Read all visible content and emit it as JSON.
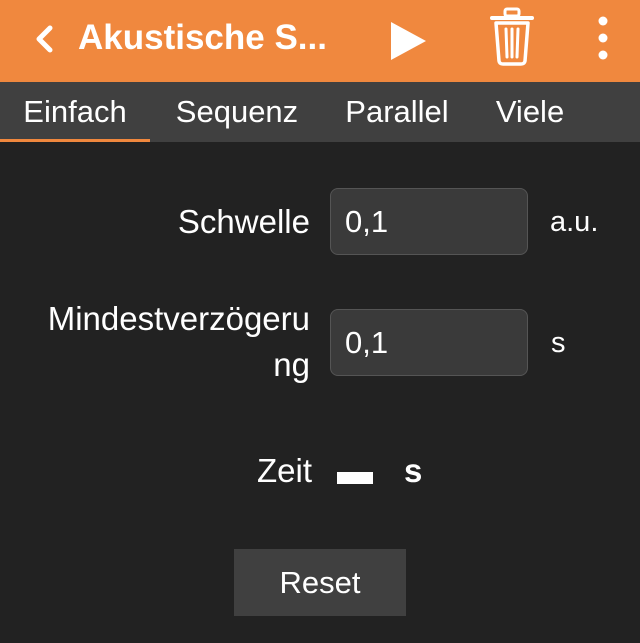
{
  "appbar": {
    "title": "Akustische S...",
    "background_color": "#f0883e",
    "icons": {
      "back": "chevron-left-icon",
      "play": "play-icon",
      "delete": "trash-icon",
      "more": "more-vertical-icon"
    }
  },
  "tabs": [
    {
      "label": "Einfach",
      "active": true
    },
    {
      "label": "Sequenz",
      "active": false
    },
    {
      "label": "Parallel",
      "active": false
    },
    {
      "label": "Viele",
      "active": false
    }
  ],
  "form": {
    "threshold": {
      "label": "Schwelle",
      "value": "0,1",
      "unit": "a.u."
    },
    "min_delay": {
      "label_line1": "Mindestverzögeru",
      "label_line2": "ng",
      "value": "0,1",
      "unit": "s"
    },
    "time": {
      "label": "Zeit",
      "unit": "s"
    }
  },
  "reset_button": {
    "label": "Reset"
  },
  "colors": {
    "accent": "#f0883e",
    "background": "#222222",
    "tabbar": "#404040",
    "input_bg": "#3a3a3a"
  }
}
